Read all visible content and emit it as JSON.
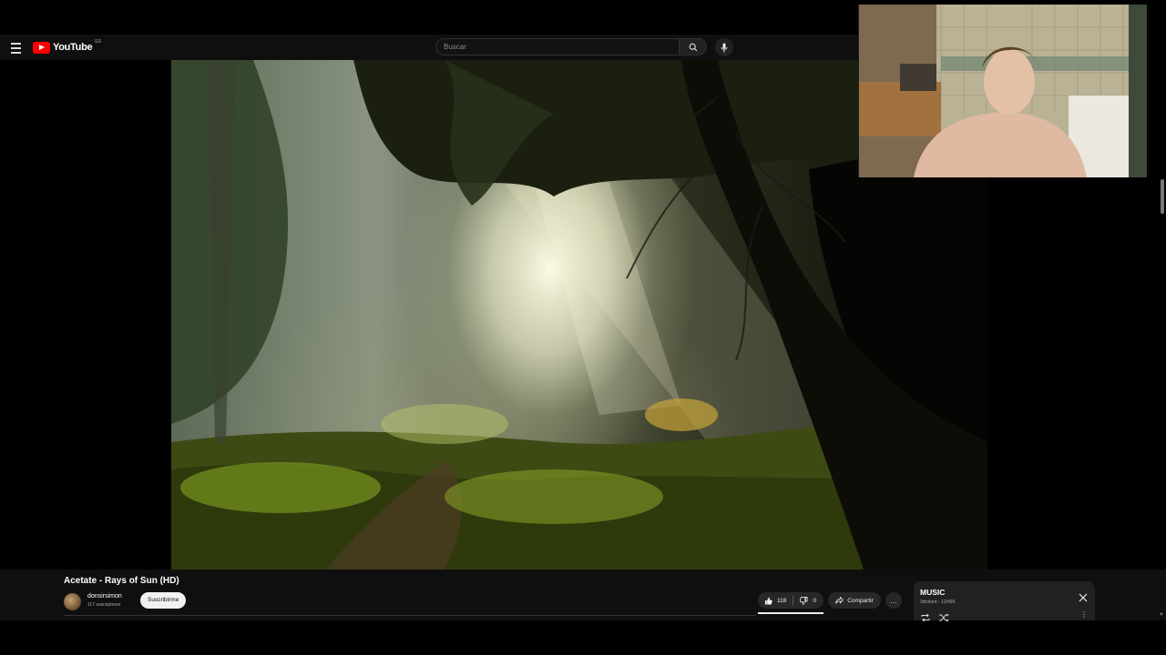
{
  "header": {
    "logo_text": "YouTube",
    "logo_country": "ES",
    "search_placeholder": "Buscar"
  },
  "video": {
    "title": "Acetate - Rays of Sun (HD)",
    "channel": "donsirsimon",
    "subscribers": "117 suscriptores",
    "subscribe_label": "Suscribirme",
    "likes": "118",
    "dislikes": "0",
    "share_label": "Compartir",
    "more_label": "…"
  },
  "playlist": {
    "title": "MUSIC",
    "subtitle": "3drobert - 12/490"
  },
  "icons": {
    "menu": "hamburger-icon",
    "search": "search-icon",
    "mic": "mic-icon",
    "like": "thumb-up-icon",
    "dislike": "thumb-down-icon",
    "share": "share-icon",
    "close": "close-icon",
    "repeat": "repeat-icon",
    "shuffle": "shuffle-icon"
  },
  "colors": {
    "brand_red": "#ff0000",
    "background": "#0f0f0f",
    "pill": "#272727"
  }
}
